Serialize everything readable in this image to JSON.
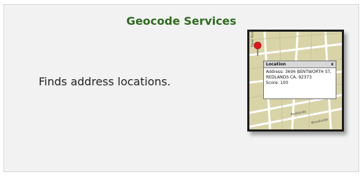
{
  "card": {
    "title": "Geocode Services",
    "description": "Finds address locations."
  },
  "map_thumbnail": {
    "popup": {
      "title": "Location",
      "close_glyph": "x",
      "lines": [
        "Address: 3606 BENTWORTH ST,",
        "REDLANDS CA, 92373",
        "Score: 100"
      ]
    },
    "colors": {
      "map_bg": "#d9d4a8",
      "road": "#ffffff",
      "marker": "#e0161b"
    }
  },
  "colors": {
    "title": "#2f6b1f",
    "card_bg": "#f2f2f2",
    "card_border": "#d6d6d6"
  }
}
